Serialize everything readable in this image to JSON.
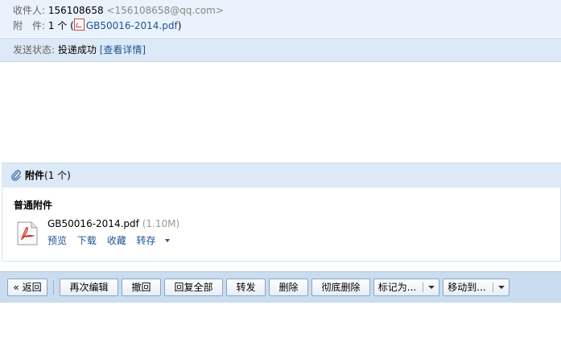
{
  "header": {
    "recipient_label": "收件人:",
    "recipient_id": "156108658",
    "recipient_email": "<156108658@qq.com>",
    "attach_label": "附　件:",
    "attach_count": "1 个 (",
    "attach_file": "GB50016-2014.pdf",
    "attach_close": ")"
  },
  "status": {
    "label": "发送状态:",
    "value": "投递成功",
    "details_link": "[查看详情]"
  },
  "attachments": {
    "title": "附件",
    "count": "(1 个)",
    "section": "普通附件",
    "file": {
      "name": "GB50016-2014.pdf",
      "size": "(1.10M)",
      "actions": [
        "预览",
        "下载",
        "收藏",
        "转存"
      ]
    }
  },
  "toolbar": {
    "back": "« 返回",
    "re_edit": "再次编辑",
    "recall": "撤回",
    "reply_all": "回复全部",
    "forward": "转发",
    "delete": "删除",
    "delete_perm": "彻底删除",
    "mark_as": "标记为...",
    "move_to": "移动到..."
  },
  "colors": {
    "link": "#1e5494",
    "header_bg": "#eaf2fb",
    "bar_bg": "#dde9f7",
    "toolbar_bg": "#c9dcf0"
  }
}
